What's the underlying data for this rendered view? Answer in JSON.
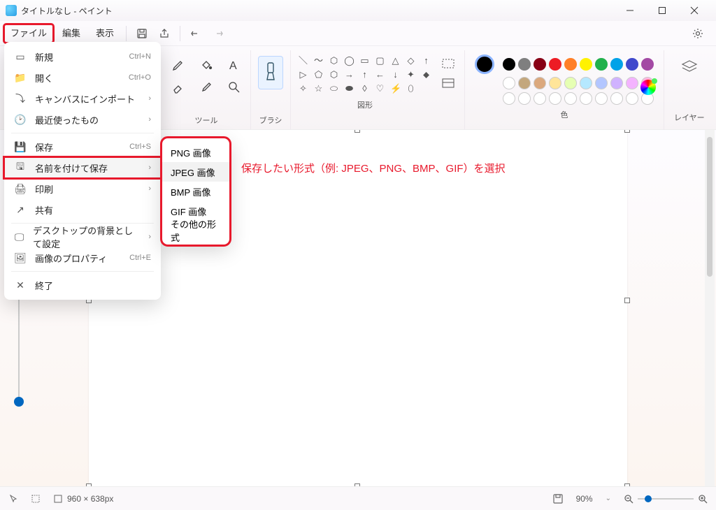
{
  "title": "タイトルなし - ペイント",
  "menubar": {
    "file": "ファイル",
    "edit": "編集",
    "view": "表示"
  },
  "ribbon": {
    "tools_label": "ツール",
    "brush_label": "ブラシ",
    "shapes_label": "図形",
    "colors_label": "色",
    "layers_label": "レイヤー"
  },
  "file_menu": {
    "new": "新規",
    "new_sc": "Ctrl+N",
    "open": "開く",
    "open_sc": "Ctrl+O",
    "import": "キャンバスにインポート",
    "recent": "最近使ったもの",
    "save": "保存",
    "save_sc": "Ctrl+S",
    "save_as": "名前を付けて保存",
    "print": "印刷",
    "share": "共有",
    "wallpaper": "デスクトップの背景として設定",
    "props": "画像のプロパティ",
    "props_sc": "Ctrl+E",
    "exit": "終了"
  },
  "save_as_submenu": {
    "png": "PNG 画像",
    "jpeg": "JPEG 画像",
    "bmp": "BMP 画像",
    "gif": "GIF 画像",
    "other": "その他の形式"
  },
  "annotation": "保存したい形式（例: JPEG、PNG、BMP、GIF）を選択",
  "statusbar": {
    "dims": "960 × 638px",
    "zoom": "90%"
  },
  "colors": {
    "current": "#000000",
    "row1": [
      "#000000",
      "#7f7f7f",
      "#880015",
      "#ed1c24",
      "#ff7f27",
      "#fff200",
      "#22b14c",
      "#00a2e8",
      "#3f48cc",
      "#a349a4"
    ],
    "row2": [
      "#ffffff",
      "#c3a77d",
      "#dba87d",
      "#ffe599",
      "#e6ffb3",
      "#b5e8ff",
      "#b3c6ff",
      "#d0b3ff",
      "#f4b3ff",
      "#ffb3de"
    ],
    "row3_empty_count": 10
  }
}
